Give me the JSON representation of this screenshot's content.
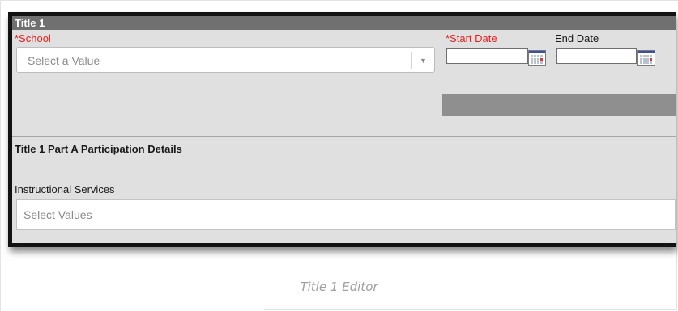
{
  "panel": {
    "title": "Title 1",
    "school_label": "*School",
    "school_placeholder": "Select a Value",
    "start_date_label": "*Start Date",
    "end_date_label": "End Date",
    "start_date_value": "",
    "end_date_value": "",
    "section_heading": "Title 1 Part A Participation Details",
    "instructional_label": "Instructional Services",
    "instructional_placeholder": "Select Values"
  },
  "caption": "Title 1 Editor",
  "colors": {
    "required": "#ee1c1c",
    "header_bar": "#707070",
    "panel_bg": "#e0e0e0"
  },
  "icons": [
    "dropdown-arrow-icon",
    "calendar-icon"
  ]
}
